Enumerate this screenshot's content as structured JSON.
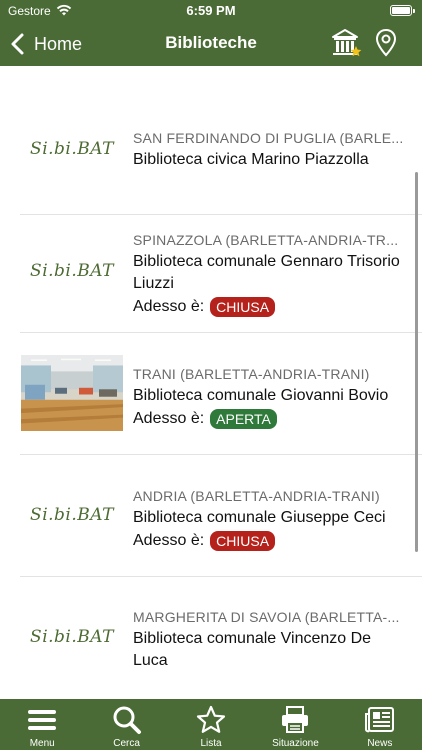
{
  "status_bar": {
    "carrier": "Gestore",
    "time": "6:59 PM"
  },
  "nav": {
    "back_label": "Home",
    "title": "Biblioteche"
  },
  "colors": {
    "brand_green": "#4a6b35",
    "closed_red": "#b5211b",
    "open_green": "#2f7a3a"
  },
  "libraries": [
    {
      "logo_text": "Si.bi.BAT",
      "place": "SAN FERDINANDO DI PUGLIA (BARLE...",
      "name": "Biblioteca civica Marino Piazzolla"
    },
    {
      "logo_text": "Si.bi.BAT",
      "place": "SPINAZZOLA (BARLETTA-ANDRIA-TR...",
      "name": "Biblioteca comunale Gennaro Trisorio Liuzzi",
      "status_prefix": "Adesso è:",
      "status": "CHIUSA"
    },
    {
      "place": "TRANI (BARLETTA-ANDRIA-TRANI)",
      "name": "Biblioteca comunale Giovanni Bovio",
      "status_prefix": "Adesso è:",
      "status": "APERTA"
    },
    {
      "logo_text": "Si.bi.BAT",
      "place": "ANDRIA (BARLETTA-ANDRIA-TRANI)",
      "name": "Biblioteca comunale Giuseppe Ceci",
      "status_prefix": "Adesso è:",
      "status": "CHIUSA"
    },
    {
      "logo_text": "Si.bi.BAT",
      "place": "MARGHERITA DI SAVOIA (BARLETTA-...",
      "name": "Biblioteca comunale Vincenzo De Luca"
    }
  ],
  "tabs": [
    {
      "label": "Menu",
      "icon": "hamburger-icon"
    },
    {
      "label": "Cerca",
      "icon": "search-icon"
    },
    {
      "label": "Lista",
      "icon": "star-icon"
    },
    {
      "label": "Situazione",
      "icon": "printer-icon"
    },
    {
      "label": "News",
      "icon": "newspaper-icon"
    }
  ]
}
